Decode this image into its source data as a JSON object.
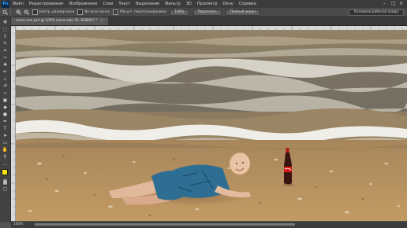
{
  "app": {
    "logo": "Ps"
  },
  "menu": [
    "Файл",
    "Редактирование",
    "Изображение",
    "Слои",
    "Текст",
    "Выделение",
    "Фильтр",
    "3D",
    "Просмотр",
    "Окно",
    "Справка"
  ],
  "options_bar": {
    "resize_windows_label": "Настр. размер окон",
    "all_windows_label": "Во всех окнах",
    "scrubby_zoom_label": "Масшт. перетаскиванием",
    "zoom_button": "100%",
    "fit_screen_button": "Подогнать",
    "fill_screen_button": "Полный экран",
    "workspace": "Основная рабочая среда"
  },
  "document_tab": {
    "title": "пляж как.psd @ 100% (coca cola 35, RGB/8*) *",
    "close": "×"
  },
  "status_bar": {
    "zoom": "100%"
  },
  "colors": {
    "foreground": "#f2e40c",
    "background": "#ffffff",
    "sand": "#b8905e",
    "water": "#7a7062",
    "foam": "#ecebe5",
    "shirt": "#2f6e93"
  }
}
